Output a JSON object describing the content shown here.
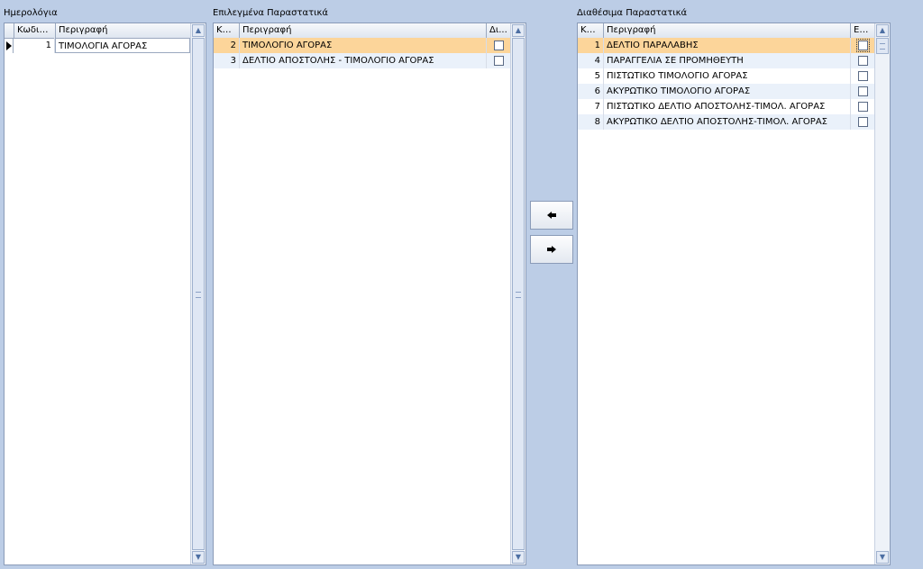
{
  "journals": {
    "title": "Ημερολόγια",
    "columns": [
      "Κωδικός",
      "Περιγραφή"
    ],
    "rows": [
      {
        "code": "1",
        "desc": "ΤΙΜΟΛΟΓΙΑ ΑΓΟΡΑΣ"
      }
    ]
  },
  "selected_docs": {
    "title": "Επιλεγμένα Παραστατικά",
    "columns": [
      "Κω...",
      "Περιγραφή",
      "Δι..."
    ],
    "rows": [
      {
        "code": "2",
        "desc": "ΤΙΜΟΛΟΓΙΟ ΑΓΟΡΑΣ",
        "checked": false
      },
      {
        "code": "3",
        "desc": "ΔΕΛΤΙΟ ΑΠΟΣΤΟΛΗΣ - ΤΙΜΟΛΟΓΙΟ ΑΓΟΡΑΣ",
        "checked": false
      }
    ]
  },
  "available_docs": {
    "title": "Διαθέσιμα Παραστατικά",
    "columns": [
      "Κω...",
      "Περιγραφή",
      "Επ..."
    ],
    "rows": [
      {
        "code": "1",
        "desc": "ΔΕΛΤΙΟ ΠΑΡΑΛΑΒΗΣ",
        "checked": false
      },
      {
        "code": "4",
        "desc": "ΠΑΡΑΓΓΕΛΙΑ ΣΕ ΠΡΟΜΗΘΕΥΤΗ",
        "checked": false
      },
      {
        "code": "5",
        "desc": "ΠΙΣΤΩΤΙΚΟ ΤΙΜΟΛΟΓΙΟ ΑΓΟΡΑΣ",
        "checked": false
      },
      {
        "code": "6",
        "desc": "ΑΚΥΡΩΤΙΚΟ ΤΙΜΟΛΟΓΙΟ ΑΓΟΡΑΣ",
        "checked": false
      },
      {
        "code": "7",
        "desc": "ΠΙΣΤΩΤΙΚΟ ΔΕΛΤΙΟ ΑΠΟΣΤΟΛΗΣ-ΤΙΜΟΛ. ΑΓΟΡΑΣ",
        "checked": false
      },
      {
        "code": "8",
        "desc": "ΑΚΥΡΩΤΙΚΟ ΔΕΛΤΙΟ ΑΠΟΣΤΟΛΗΣ-ΤΙΜΟΛ. ΑΓΟΡΑΣ",
        "checked": false
      }
    ]
  },
  "icons": {
    "move_left": "arrow-left-icon",
    "move_right": "arrow-right-icon"
  },
  "colors": {
    "background": "#bccde6",
    "selected_row": "#fcd59a",
    "alt_row": "#eaf1fa"
  }
}
